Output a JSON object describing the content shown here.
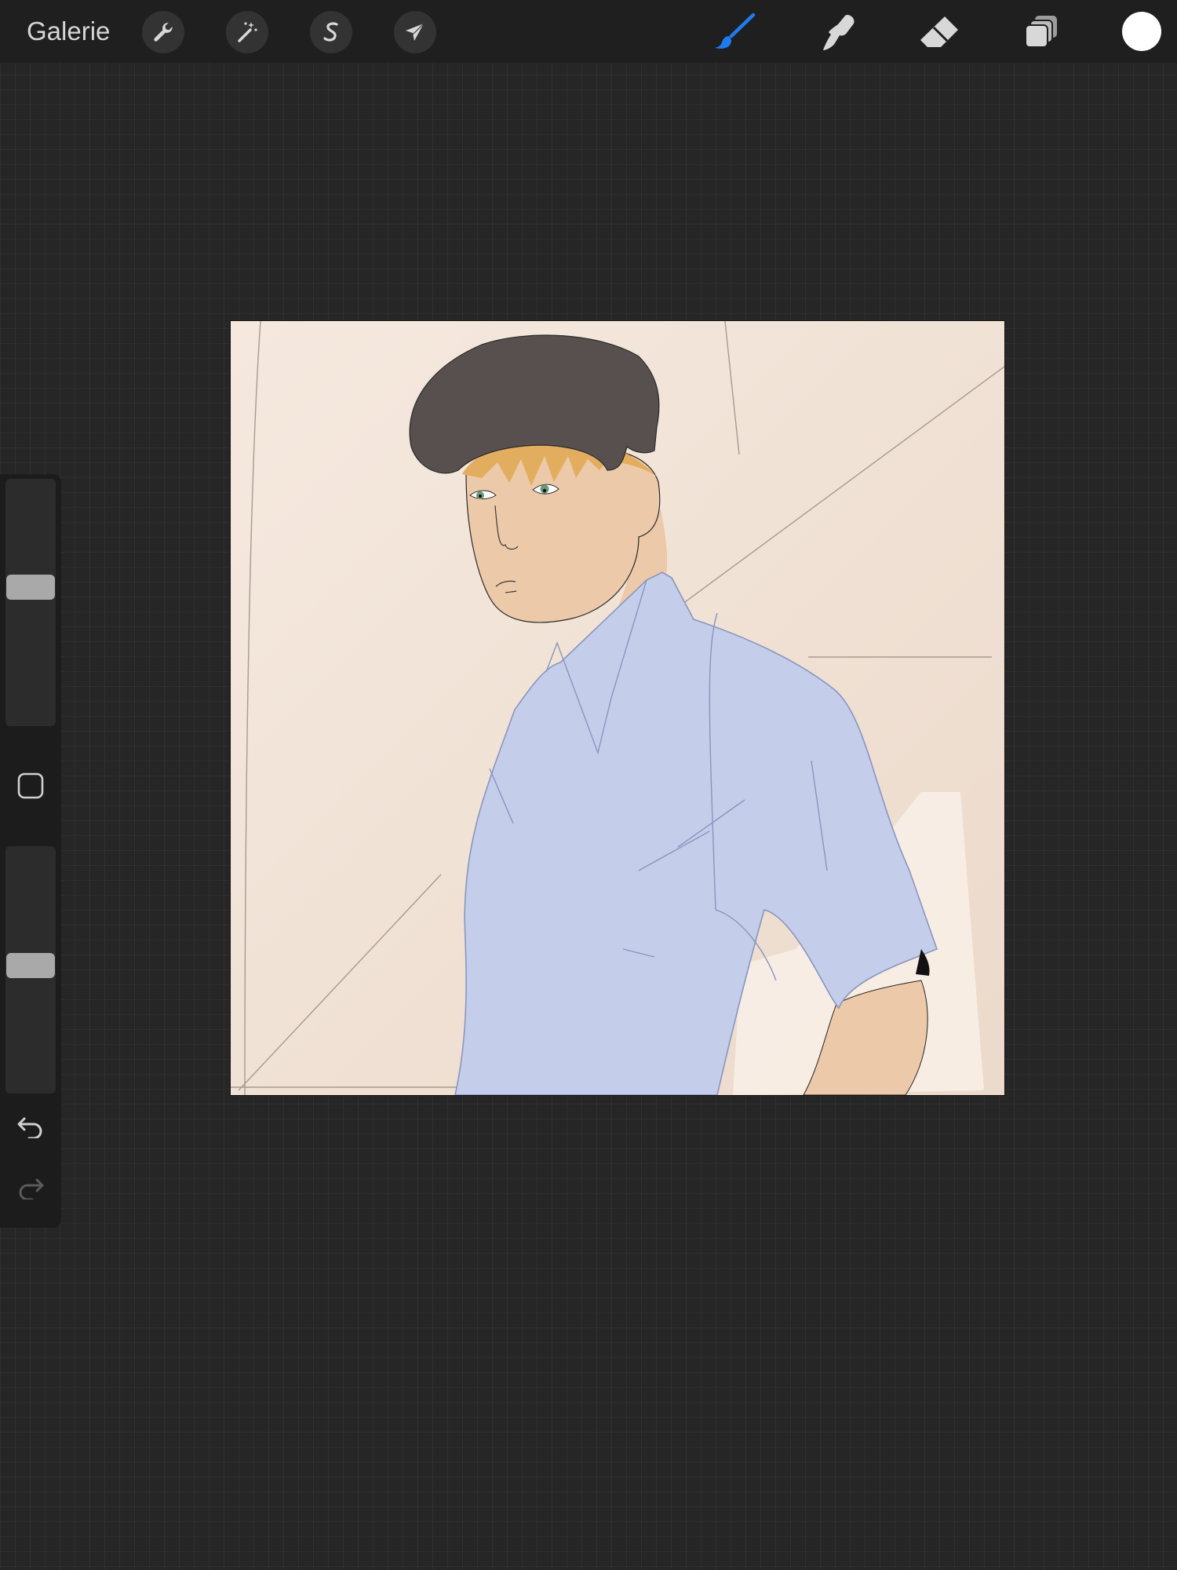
{
  "app": {
    "gallery_label": "Galerie"
  },
  "toolbar": {
    "left_tools": [
      {
        "name": "actions",
        "icon": "wrench-icon"
      },
      {
        "name": "adjustments",
        "icon": "magic-wand-icon"
      },
      {
        "name": "selection",
        "icon": "selection-s-icon"
      },
      {
        "name": "transform",
        "icon": "arrow-cursor-icon"
      }
    ],
    "right_tools": [
      {
        "name": "brush",
        "icon": "brush-icon",
        "active": true
      },
      {
        "name": "smudge",
        "icon": "smudge-icon",
        "active": false
      },
      {
        "name": "eraser",
        "icon": "eraser-icon",
        "active": false
      },
      {
        "name": "layers",
        "icon": "layers-icon",
        "active": false
      }
    ],
    "current_color": "#ffffff",
    "active_color": "#1f7cf0"
  },
  "sidebar": {
    "brush_size_level": 0.57,
    "brush_opacity_level": 0.52,
    "undo_enabled": true,
    "redo_enabled": false
  },
  "artwork": {
    "background_color": "#f1e3d8",
    "hair_color": "#57504e",
    "fringe_color": "#e2ad5e",
    "skin_color": "#ecc9a8",
    "shirt_color": "#c4cde9",
    "eye_color": "#6a9a7a"
  }
}
